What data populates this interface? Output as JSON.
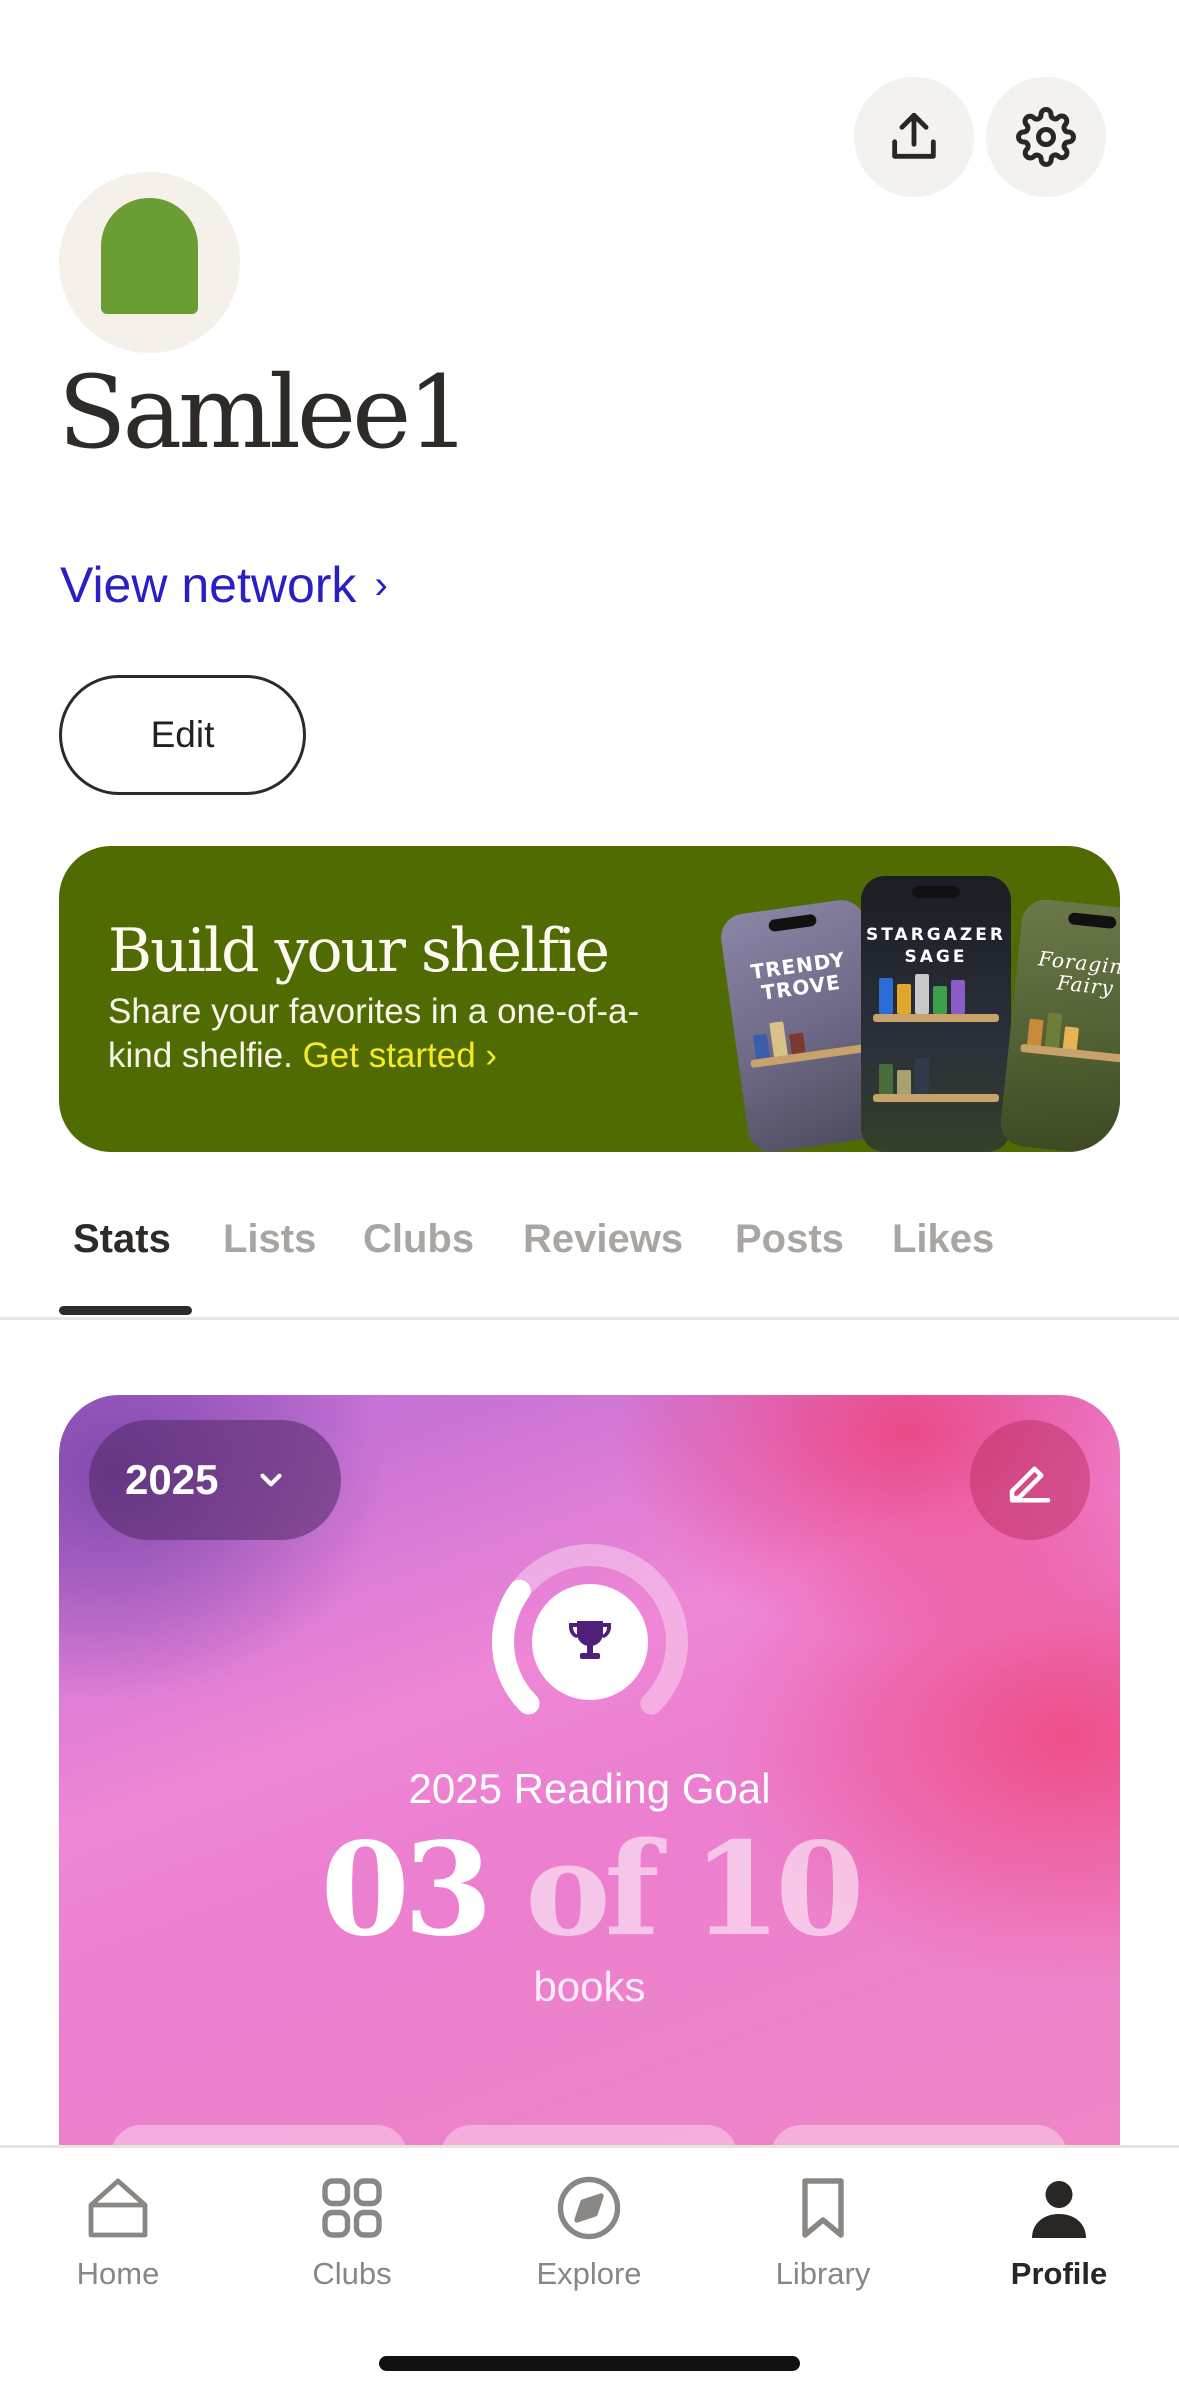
{
  "header": {
    "share_icon": "share-upload-icon",
    "settings_icon": "gear-icon"
  },
  "profile": {
    "username": "Samlee1",
    "view_network": "View network",
    "view_network_chevron": "›",
    "edit_label": "Edit",
    "avatar_color": "#6a9e34"
  },
  "shelfie": {
    "title": "Build your shelfie",
    "body": "Share your favorites in a one-of-a-kind shelfie.",
    "cta": "Get started ›",
    "phones": [
      "TRENDY TROVE",
      "STARGAZER SAGE",
      "Foraging Fairy"
    ],
    "bg_color": "#516b03",
    "cta_color": "#f5ea24"
  },
  "tabs": [
    {
      "label": "Stats",
      "active": true
    },
    {
      "label": "Lists",
      "active": false
    },
    {
      "label": "Clubs",
      "active": false
    },
    {
      "label": "Reviews",
      "active": false
    },
    {
      "label": "Posts",
      "active": false
    },
    {
      "label": "Likes",
      "active": false
    }
  ],
  "goal": {
    "year": "2025",
    "title": "2025 Reading Goal",
    "count_read": "03",
    "count_rest": " of 10",
    "unit": "books",
    "progress": 0.3
  },
  "nav": [
    {
      "label": "Home",
      "icon": "home-icon",
      "active": false
    },
    {
      "label": "Clubs",
      "icon": "clubs-grid-icon",
      "active": false
    },
    {
      "label": "Explore",
      "icon": "compass-icon",
      "active": false
    },
    {
      "label": "Library",
      "icon": "bookmark-icon",
      "active": false
    },
    {
      "label": "Profile",
      "icon": "person-icon",
      "active": true
    }
  ]
}
